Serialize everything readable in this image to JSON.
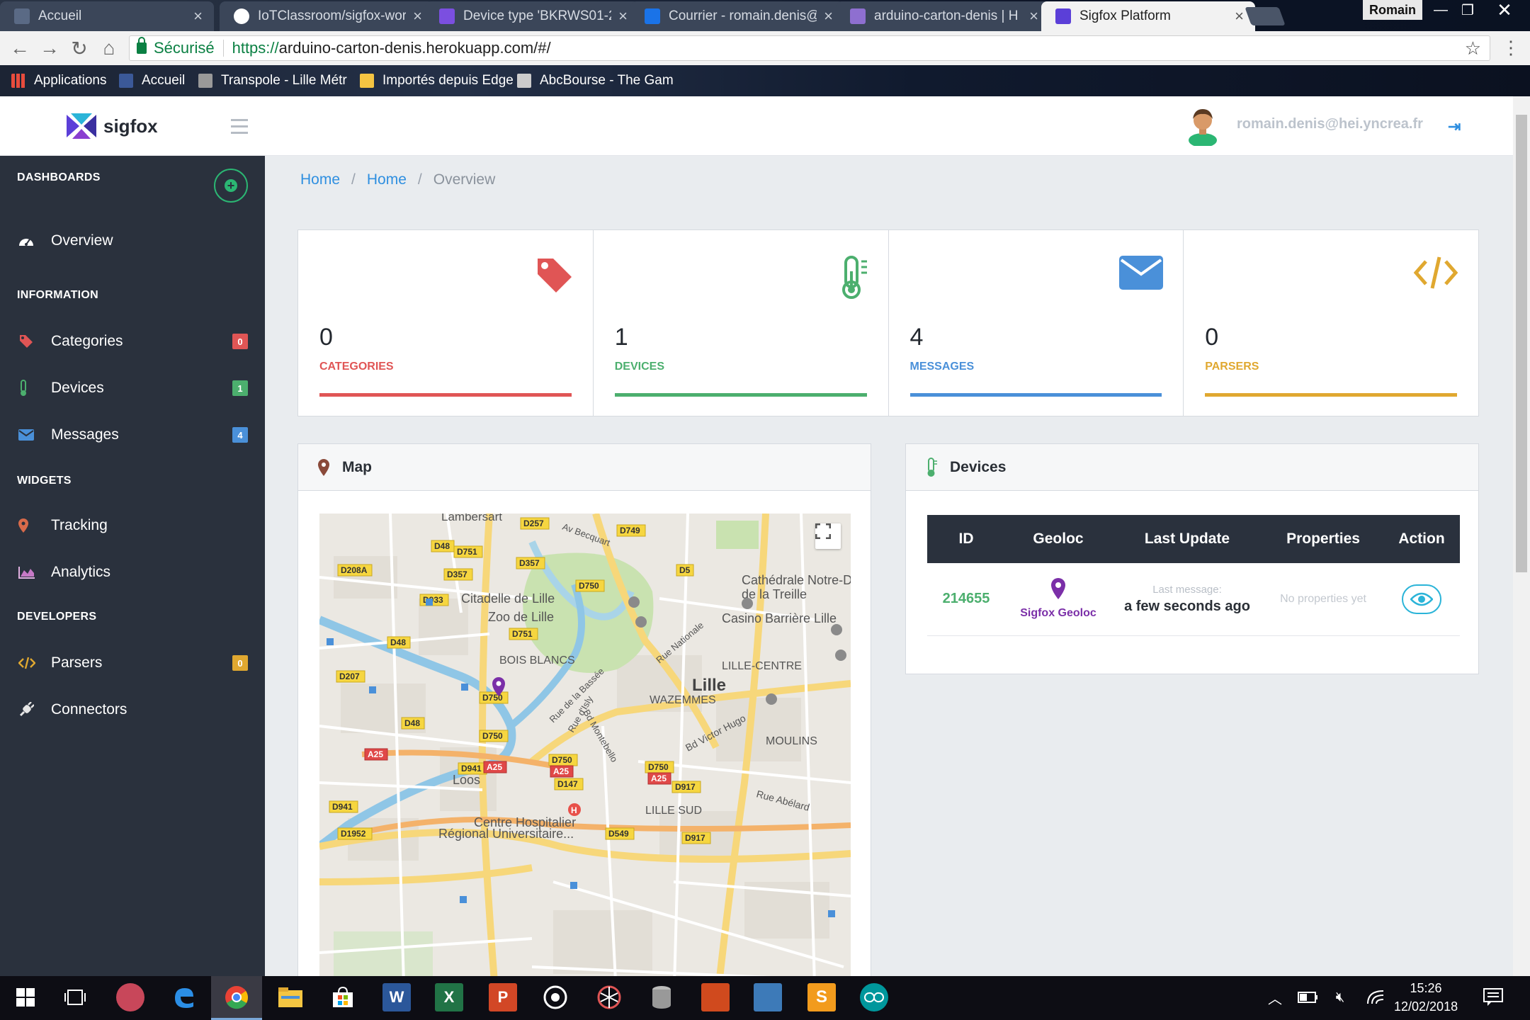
{
  "browser": {
    "tabs": [
      {
        "title": "Accueil",
        "fav_color": "#5a6a85"
      },
      {
        "title": "IoTClassroom/sigfox-wor",
        "fav_color": "#ffffff"
      },
      {
        "title": "Device type 'BKRWS01-2",
        "fav_color": "#7b4fe0"
      },
      {
        "title": "Courrier - romain.denis@",
        "fav_color": "#1a73e8"
      },
      {
        "title": "arduino-carton-denis | H",
        "fav_color": "#8e6fd0"
      },
      {
        "title": "Sigfox Platform",
        "fav_color": "#5b3fd8"
      }
    ],
    "window_user": "Romain",
    "secure_label": "Sécurisé",
    "url_scheme": "https://",
    "url_rest": "arduino-carton-denis.herokuapp.com/#/",
    "bookmarks": [
      {
        "label": "Applications",
        "color": "#e84c3d"
      },
      {
        "label": "Accueil",
        "color": "#3b5998"
      },
      {
        "label": "Transpole - Lille Métr",
        "color": "#999999"
      },
      {
        "label": "Importés depuis Edge",
        "color": "#f5c542"
      },
      {
        "label": "AbcBourse - The Gam",
        "color": "#cccccc"
      }
    ]
  },
  "app": {
    "logo_text": "sigfox",
    "user_email": "romain.denis@hei.yncrea.fr",
    "logout_icon": "sign-out-icon"
  },
  "sidebar": {
    "dashboards_header": "DASHBOARDS",
    "information_header": "INFORMATION",
    "widgets_header": "WIDGETS",
    "developers_header": "DEVELOPERS",
    "items": {
      "overview": {
        "label": "Overview",
        "icon": "dashboard-icon"
      },
      "categories": {
        "label": "Categories",
        "badge": "0",
        "badge_color": "#e05555"
      },
      "devices": {
        "label": "Devices",
        "badge": "1",
        "badge_color": "#4caf6e"
      },
      "messages": {
        "label": "Messages",
        "badge": "4",
        "badge_color": "#4a90d9"
      },
      "tracking": {
        "label": "Tracking"
      },
      "analytics": {
        "label": "Analytics"
      },
      "parsers": {
        "label": "Parsers",
        "badge": "0",
        "badge_color": "#e0a830"
      },
      "connectors": {
        "label": "Connectors"
      }
    }
  },
  "breadcrumb": [
    "Home",
    "Home",
    "Overview"
  ],
  "stats": [
    {
      "value": "0",
      "label": "CATEGORIES",
      "color": "#e05555",
      "icon": "tag-icon"
    },
    {
      "value": "1",
      "label": "DEVICES",
      "color": "#4caf6e",
      "icon": "thermometer-icon"
    },
    {
      "value": "4",
      "label": "MESSAGES",
      "color": "#4a90d9",
      "icon": "envelope-icon"
    },
    {
      "value": "0",
      "label": "PARSERS",
      "color": "#e0a830",
      "icon": "code-icon"
    }
  ],
  "map_card": {
    "title": "Map",
    "labels": {
      "lambersart": "Lambersart",
      "citadelle": "Citadelle de Lille",
      "zoo": "Zoo de Lille",
      "bois_blancs": "BOIS BLANCS",
      "cathedrale": "Cathédrale Notre-D",
      "treille": "de la Treille",
      "casino": "Casino Barrière Lille",
      "lille_centre": "LILLE-CENTRE",
      "lille": "Lille",
      "wazemmes": "WAZEMMES",
      "moulins": "MOULINS",
      "loos": "Loos",
      "lille_sud": "LILLE SUD",
      "chu1": "Centre Hospitalier",
      "chu2": "Régional Universitaire...",
      "rue_nationale": "Rue Nationale",
      "bd_victor_hugo": "Bd Victor Hugo",
      "rue_abelard": "Rue Abélard",
      "av_becquart": "Av Becquart",
      "rue_bassee": "Rue de la Bassée",
      "bd_montebello": "Bd Montebello",
      "rue_isly": "Rue d'Isly"
    },
    "road_tags": [
      "D257",
      "D48",
      "D751",
      "D749",
      "D208A",
      "D357",
      "D357",
      "D5",
      "D933",
      "D750",
      "D751",
      "D48",
      "D207",
      "D750",
      "D48",
      "D750",
      "A25",
      "D941",
      "A25",
      "D750",
      "A25",
      "D750",
      "A25",
      "D147",
      "D917",
      "D941",
      "D1952",
      "D549",
      "D917"
    ]
  },
  "devices_card": {
    "title": "Devices",
    "columns": [
      "ID",
      "Geoloc",
      "Last Update",
      "Properties",
      "Action"
    ],
    "rows": [
      {
        "id": "214655",
        "geoloc": "Sigfox Geoloc",
        "last_sub": "Last message:",
        "last_main": "a few seconds ago",
        "properties": "No properties yet"
      }
    ]
  },
  "taskbar": {
    "time": "15:26",
    "date": "12/02/2018"
  }
}
